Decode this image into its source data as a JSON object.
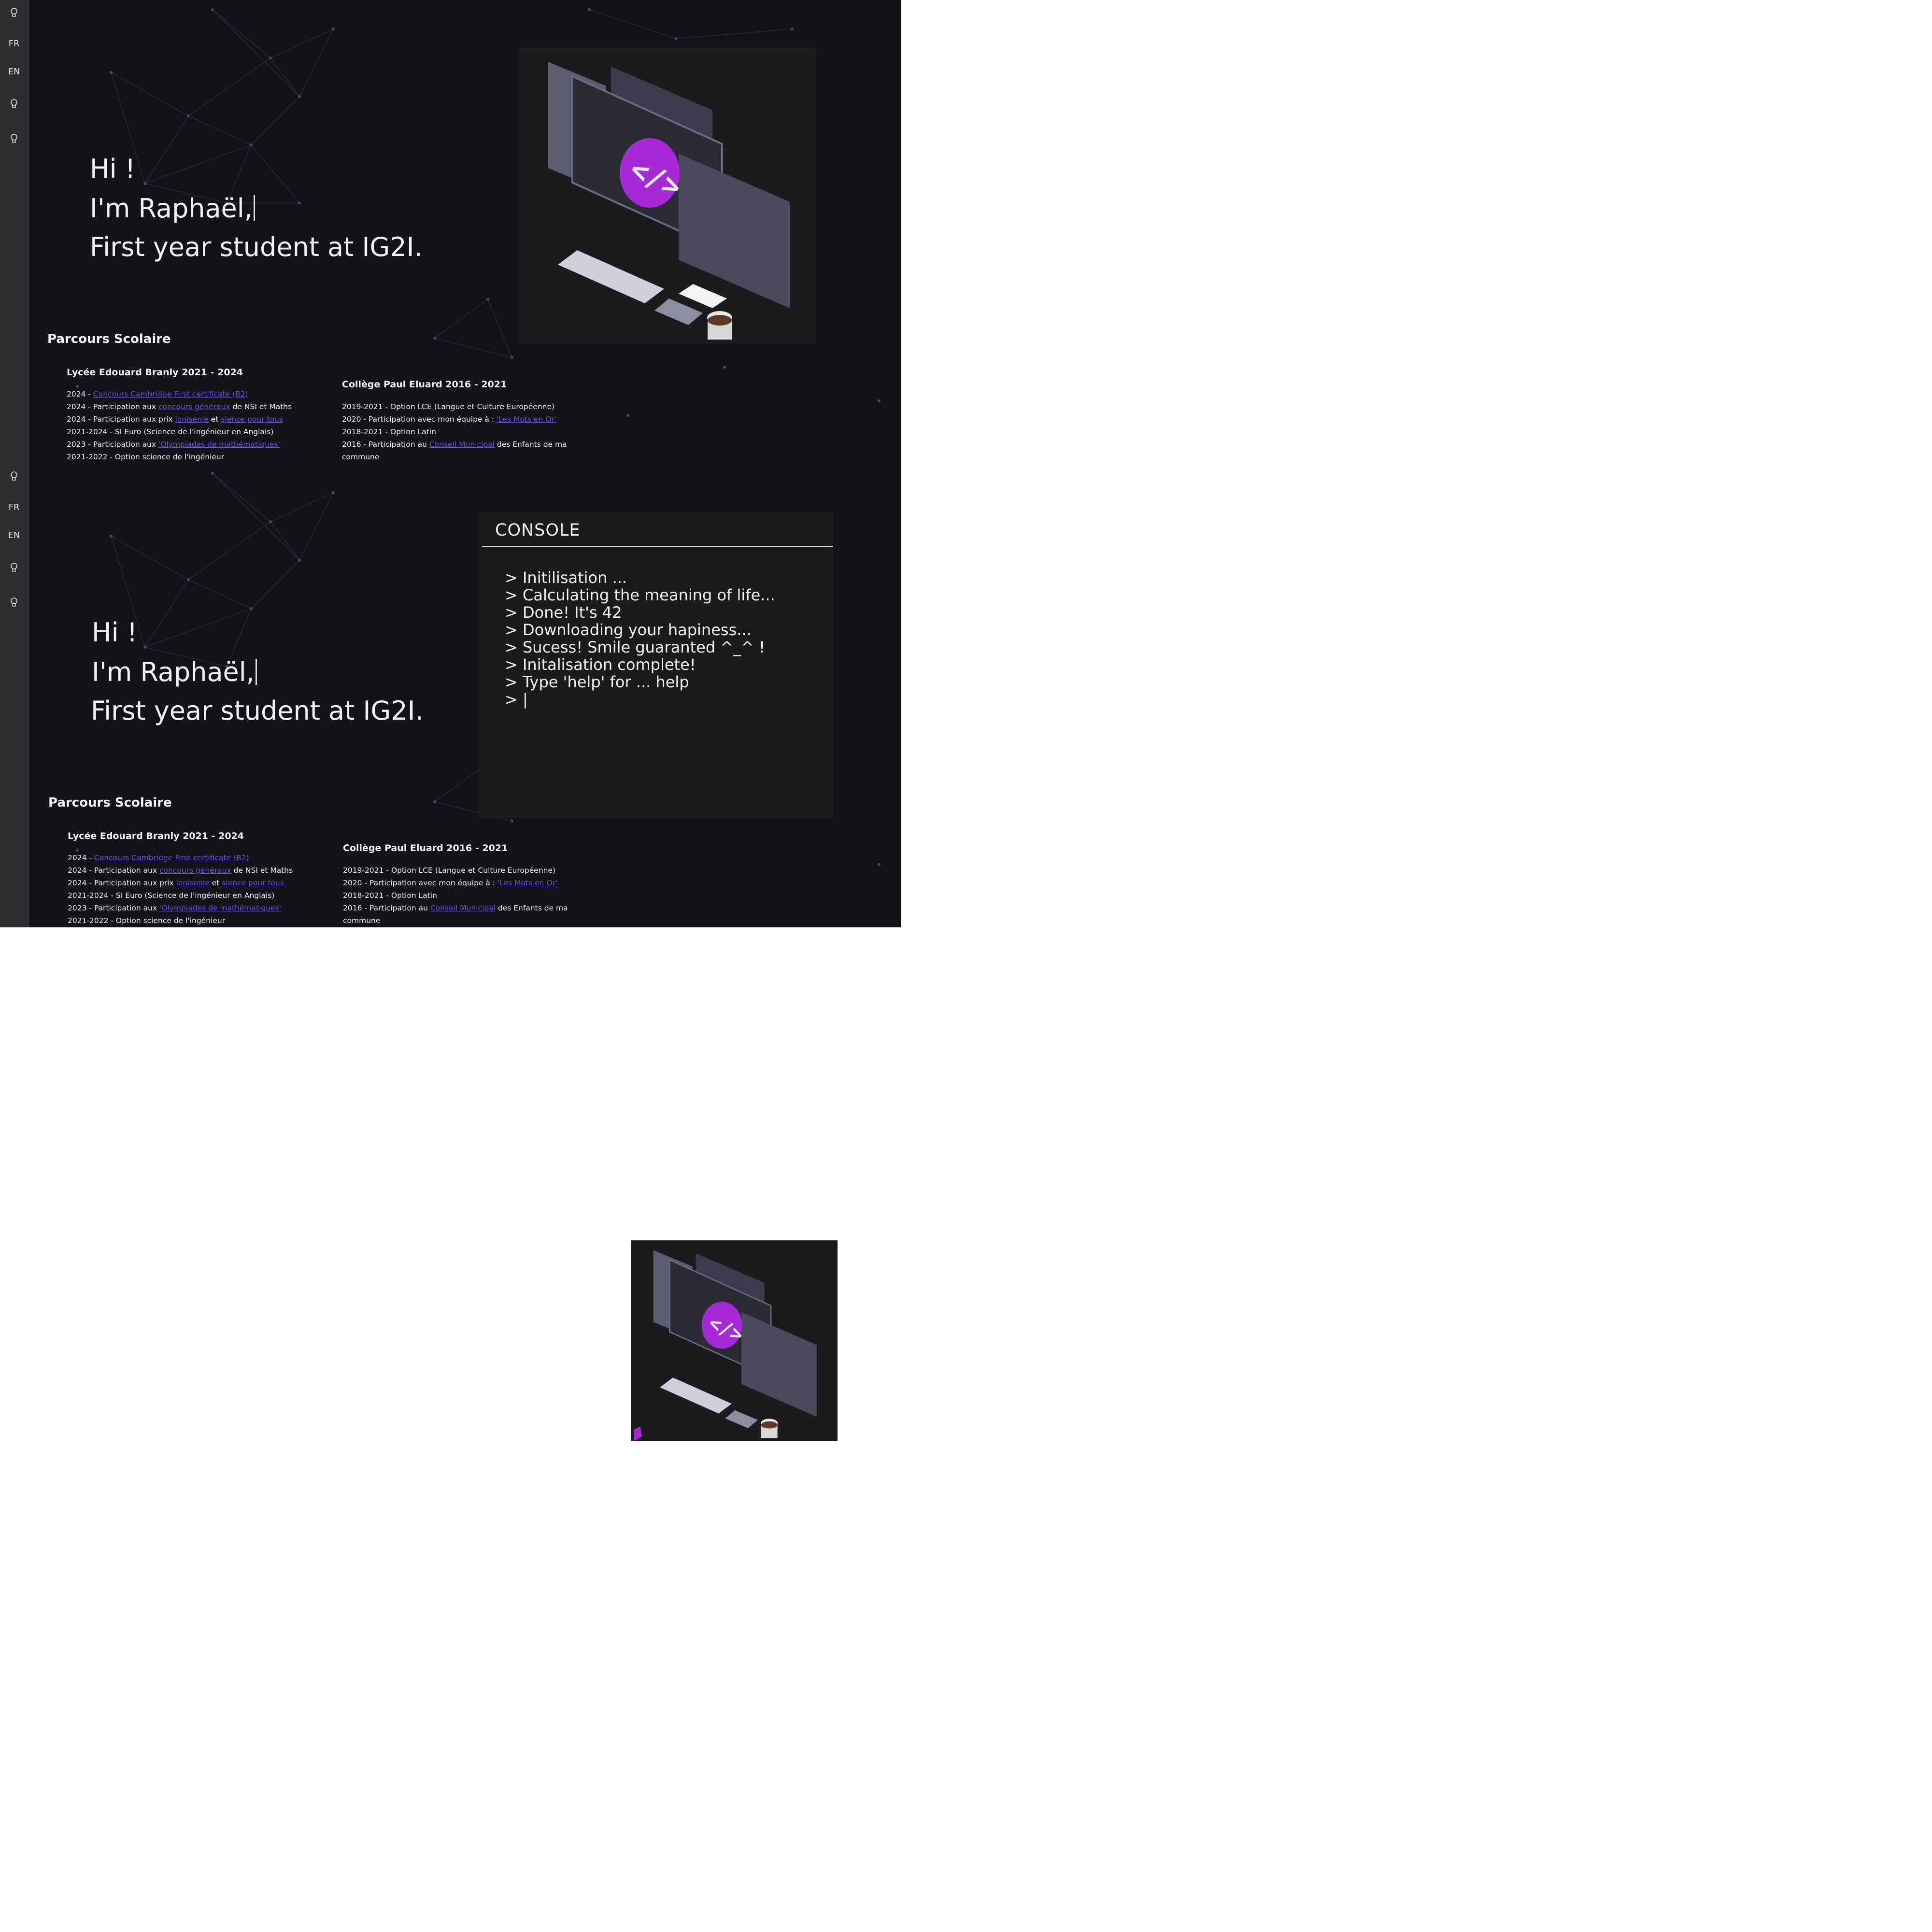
{
  "sidebar": {
    "items": [
      {
        "label": "",
        "icon": "lightbulb-icon"
      },
      {
        "label": "FR",
        "icon": ""
      },
      {
        "label": "EN",
        "icon": ""
      },
      {
        "label": "",
        "icon": "lightbulb-icon"
      },
      {
        "label": "",
        "icon": "lightbulb-icon"
      }
    ]
  },
  "hero": {
    "line1": "Hi !",
    "line2": "I'm Raphaël,",
    "line3": "First year student at IG2I."
  },
  "education": {
    "title": "Parcours Scolaire",
    "lycee": {
      "title": "Lycée Edouard Branly 2021 - 2024",
      "items": [
        {
          "pre": "2024 - ",
          "link": "Concours Cambridge First certificate (B2)",
          "mid": "",
          "link2": "",
          "post": ""
        },
        {
          "pre": "2024 - Participation aux ",
          "link": "concours généraux",
          "mid": " de NSI et Maths",
          "link2": "",
          "post": ""
        },
        {
          "pre": "2024 - Participation aux prix ",
          "link": "ionisenle",
          "mid": " et ",
          "link2": "sience pour tous",
          "post": ""
        },
        {
          "pre": "2021-2024 - SI Euro (Science de l'ingénieur en Anglais)",
          "link": "",
          "mid": "",
          "link2": "",
          "post": ""
        },
        {
          "pre": "2023 - Participation aux ",
          "link": "'Olympiades de mathématiques'",
          "mid": "",
          "link2": "",
          "post": ""
        },
        {
          "pre": "2021-2022 - Option science de l'ingénieur",
          "link": "",
          "mid": "",
          "link2": "",
          "post": ""
        }
      ]
    },
    "college": {
      "title": "Collège Paul Eluard 2016 - 2021",
      "items": [
        {
          "pre": "2019-2021 - Option LCE (Langue et Culture Européenne)",
          "link": "",
          "post": ""
        },
        {
          "pre": "2020 - Participation avec mon équipe à : ",
          "link": "'Les Mots en Or'",
          "post": ""
        },
        {
          "pre": "2018-2021 - Option Latin",
          "link": "",
          "post": ""
        },
        {
          "pre": "2016 - Participation au ",
          "link": "Conseil Municipal",
          "post": " des Enfants de ma"
        },
        {
          "pre": "commune",
          "link": "",
          "post": ""
        }
      ]
    }
  },
  "console": {
    "title": "CONSOLE",
    "lines": [
      "> Initilisation ...",
      "> Calculating the meaning of life...",
      "> Done! It's 42",
      "> Downloading your hapiness...",
      "> Sucess! Smile guaranted ^_^ !",
      "> Initalisation complete!",
      "> Type 'help' for ... help",
      "> |"
    ]
  },
  "colors": {
    "background": "#141318",
    "sidebar": "#2d2d2f",
    "link": "#6b4fd1",
    "accent": "#a62bd6",
    "console_bg": "#1b1b1c"
  }
}
